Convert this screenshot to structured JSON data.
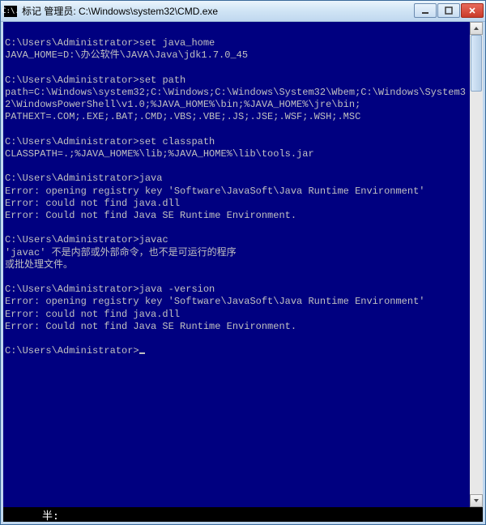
{
  "titlebar": {
    "icon_text": "C:\\.",
    "title": "标记 管理员: C:\\Windows\\system32\\CMD.exe",
    "min_label": "Minimize",
    "max_label": "Maximize",
    "close_label": "Close"
  },
  "console": {
    "lines": [
      {
        "t": "nl"
      },
      {
        "t": "prompt",
        "prompt": "C:\\Users\\Administrator>",
        "cmd": "set java_home"
      },
      {
        "t": "out",
        "text": "JAVA_HOME=D:\\办公软件\\JAVA\\Java\\jdk1.7.0_45"
      },
      {
        "t": "nl"
      },
      {
        "t": "prompt",
        "prompt": "C:\\Users\\Administrator>",
        "cmd": "set path"
      },
      {
        "t": "out",
        "text": "path=C:\\Windows\\system32;C:\\Windows;C:\\Windows\\System32\\Wbem;C:\\Windows\\System32\\WindowsPowerShell\\v1.0;%JAVA_HOME%\\bin;%JAVA_HOME%\\jre\\bin;"
      },
      {
        "t": "out",
        "text": "PATHEXT=.COM;.EXE;.BAT;.CMD;.VBS;.VBE;.JS;.JSE;.WSF;.WSH;.MSC"
      },
      {
        "t": "nl"
      },
      {
        "t": "prompt",
        "prompt": "C:\\Users\\Administrator>",
        "cmd": "set classpath"
      },
      {
        "t": "out",
        "text": "CLASSPATH=.;%JAVA_HOME%\\lib;%JAVA_HOME%\\lib\\tools.jar"
      },
      {
        "t": "nl"
      },
      {
        "t": "prompt",
        "prompt": "C:\\Users\\Administrator>",
        "cmd": "java"
      },
      {
        "t": "out",
        "text": "Error: opening registry key 'Software\\JavaSoft\\Java Runtime Environment'"
      },
      {
        "t": "out",
        "text": "Error: could not find java.dll"
      },
      {
        "t": "out",
        "text": "Error: Could not find Java SE Runtime Environment."
      },
      {
        "t": "nl"
      },
      {
        "t": "prompt",
        "prompt": "C:\\Users\\Administrator>",
        "cmd": "javac"
      },
      {
        "t": "out",
        "text": "'javac' 不是内部或外部命令，也不是可运行的程序"
      },
      {
        "t": "out",
        "text": "或批处理文件。"
      },
      {
        "t": "nl"
      },
      {
        "t": "prompt",
        "prompt": "C:\\Users\\Administrator>",
        "cmd": "java -version"
      },
      {
        "t": "out",
        "text": "Error: opening registry key 'Software\\JavaSoft\\Java Runtime Environment'"
      },
      {
        "t": "out",
        "text": "Error: could not find java.dll"
      },
      {
        "t": "out",
        "text": "Error: Could not find Java SE Runtime Environment."
      },
      {
        "t": "nl"
      },
      {
        "t": "prompt",
        "prompt": "C:\\Users\\Administrator>",
        "cmd": "",
        "cursor": true
      }
    ]
  },
  "statusbar": {
    "text": "半:"
  }
}
